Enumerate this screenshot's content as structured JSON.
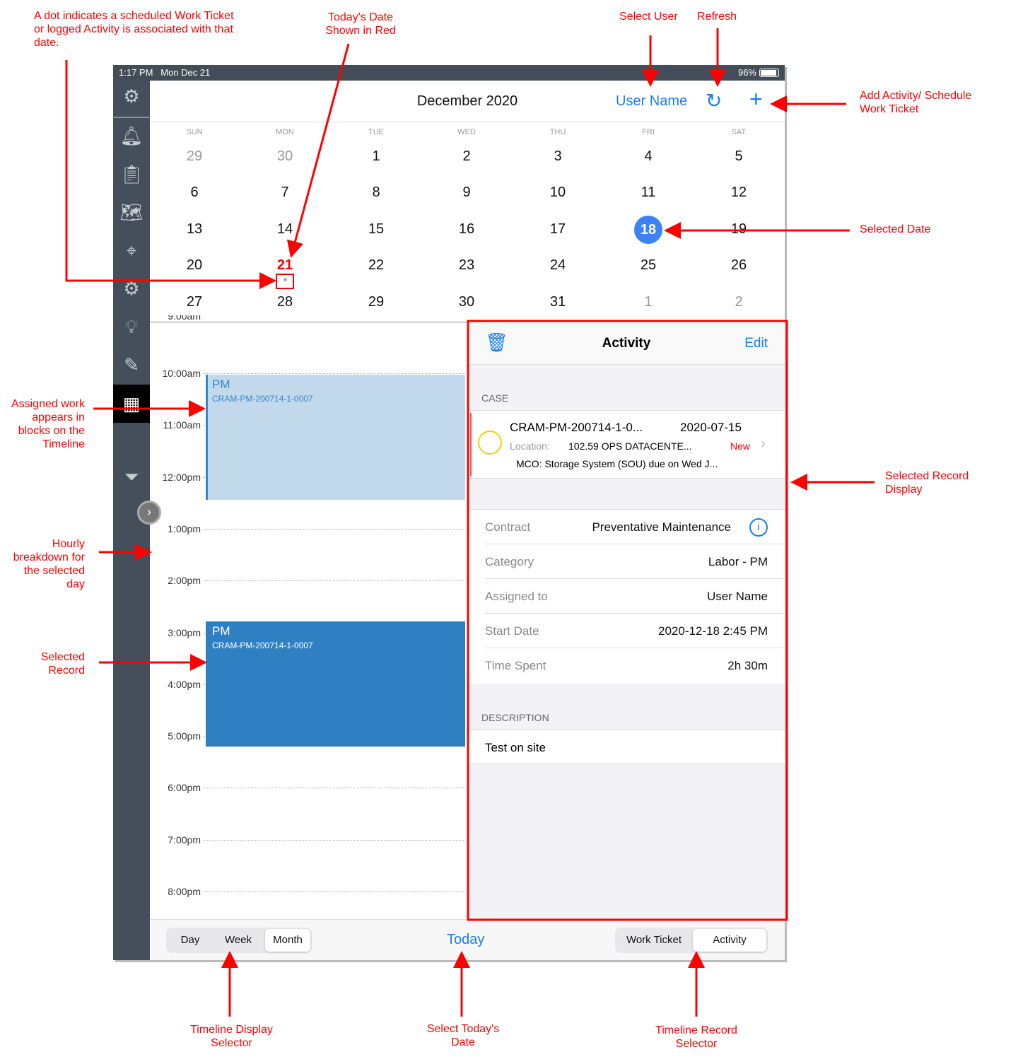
{
  "annotations": {
    "dot": "A dot indicates a scheduled Work Ticket or logged Activity is associated with that date.",
    "today": "Today's Date Shown in Red",
    "select_user": "Select User",
    "refresh": "Refresh",
    "add": "Add Activity/ Schedule Work Ticket",
    "selected_date": "Selected Date",
    "assigned_work": "Assigned work appears in blocks on the Timeline",
    "hourly": "Hourly breakdown for the selected day",
    "selected_record": "Selected Record",
    "selected_record_display": "Selected Record Display",
    "timeline_display": "Timeline Display Selector",
    "select_today": "Select Today's Date",
    "timeline_record": "Timeline Record Selector"
  },
  "status": {
    "time": "1:17 PM",
    "date": "Mon Dec 21",
    "battery": "96%"
  },
  "header": {
    "title": "December 2020",
    "user": "User Name",
    "refresh_icon": "refresh-icon",
    "add_icon": "plus-icon"
  },
  "calendar": {
    "weekdays": [
      "SUN",
      "MON",
      "TUE",
      "WED",
      "THU",
      "FRI",
      "SAT"
    ],
    "weeks": [
      [
        "29",
        "30",
        "1",
        "2",
        "3",
        "4",
        "5"
      ],
      [
        "6",
        "7",
        "8",
        "9",
        "10",
        "11",
        "12"
      ],
      [
        "13",
        "14",
        "15",
        "16",
        "17",
        "18",
        "19"
      ],
      [
        "20",
        "21",
        "22",
        "23",
        "24",
        "25",
        "26"
      ],
      [
        "27",
        "28",
        "29",
        "30",
        "31",
        "1",
        "2"
      ]
    ],
    "today": "21",
    "selected": "18",
    "accent": "#3b82f6",
    "today_color": "#ff0000"
  },
  "timeline": {
    "hours": [
      "9:00am",
      "10:00am",
      "11:00am",
      "12:00pm",
      "1:00pm",
      "2:00pm",
      "3:00pm",
      "4:00pm",
      "5:00pm",
      "6:00pm",
      "7:00pm",
      "8:00pm"
    ],
    "events": [
      {
        "title": "PM",
        "subtitle": "CRAM-PM-200714-1-0007",
        "selected": false
      },
      {
        "title": "PM",
        "subtitle": "CRAM-PM-200714-1-0007",
        "selected": true
      }
    ]
  },
  "detail": {
    "title": "Activity",
    "edit": "Edit",
    "case_header": "CASE",
    "case": {
      "id": "CRAM-PM-200714-1-0...",
      "date": "2020-07-15",
      "location_label": "Location:",
      "location": "102.59 OPS DATACENTE...",
      "status": "New",
      "desc": "MCO: Storage System (SOU) due on Wed J..."
    },
    "rows": [
      {
        "label": "Contract",
        "value": "Preventative Maintenance"
      },
      {
        "label": "Category",
        "value": "Labor - PM"
      },
      {
        "label": "Assigned to",
        "value": "User Name"
      },
      {
        "label": "Start Date",
        "value": "2020-12-18 2:45 PM"
      },
      {
        "label": "Time Spent",
        "value": "2h 30m"
      }
    ],
    "description_header": "DESCRIPTION",
    "description": "Test on site"
  },
  "bottom": {
    "views": [
      "Day",
      "Week",
      "Month"
    ],
    "active_view": "Month",
    "today": "Today",
    "records": [
      "Work Ticket",
      "Activity"
    ],
    "active_record": "Activity"
  }
}
